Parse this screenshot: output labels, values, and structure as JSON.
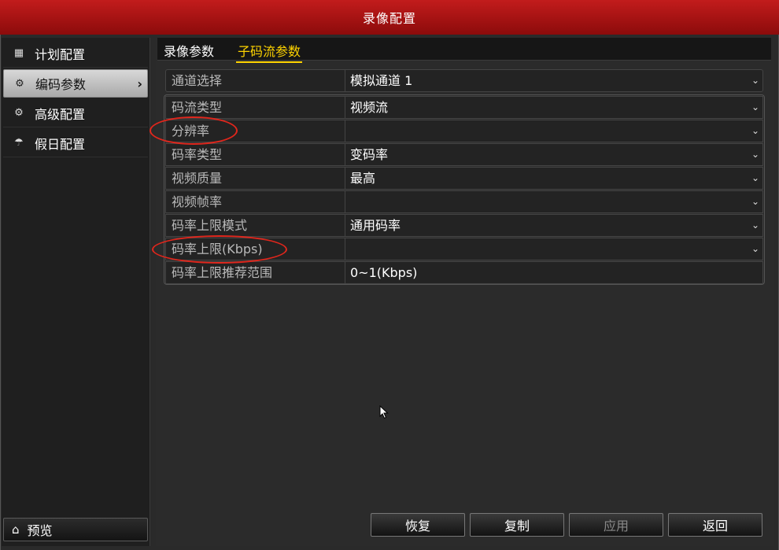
{
  "window": {
    "title": "录像配置"
  },
  "sidebar": {
    "items": [
      {
        "label": "计划配置",
        "icon": "calendar-icon"
      },
      {
        "label": "编码参数",
        "icon": "gear-icon",
        "active": true
      },
      {
        "label": "高级配置",
        "icon": "gears-icon"
      },
      {
        "label": "假日配置",
        "icon": "umbrella-icon"
      }
    ],
    "preview_label": "预览"
  },
  "tabs": [
    {
      "label": "录像参数"
    },
    {
      "label": "子码流参数",
      "active": true
    }
  ],
  "form": {
    "channel": {
      "label": "通道选择",
      "value": "模拟通道 1"
    },
    "stream_type": {
      "label": "码流类型",
      "value": "视频流"
    },
    "resolution": {
      "label": "分辨率",
      "value": ""
    },
    "bitrate_type": {
      "label": "码率类型",
      "value": "变码率"
    },
    "video_quality": {
      "label": "视频质量",
      "value": "最高"
    },
    "frame_rate": {
      "label": "视频帧率",
      "value": ""
    },
    "bitrate_mode": {
      "label": "码率上限模式",
      "value": "通用码率"
    },
    "bitrate_limit": {
      "label": "码率上限(Kbps)",
      "value": ""
    },
    "bitrate_range": {
      "label": "码率上限推荐范围",
      "value": "0~1(Kbps)"
    }
  },
  "buttons": {
    "restore": "恢复",
    "copy": "复制",
    "apply": "应用",
    "back": "返回"
  },
  "colors": {
    "title_bar": "#b01414",
    "active_tab": "#ffd400",
    "annotation": "#e0261c"
  }
}
